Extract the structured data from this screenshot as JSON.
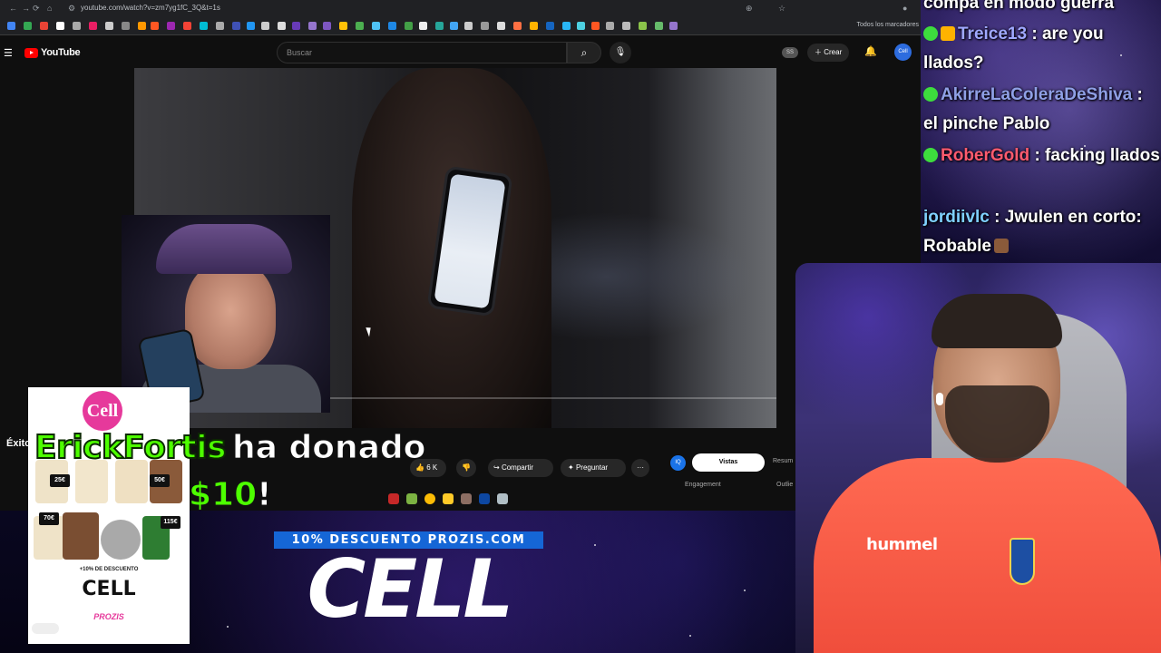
{
  "browser": {
    "url": "youtube.com/watch?v=zm7yg1fC_3Q&t=1s",
    "bookmarks_folder": "Todos los marcadores"
  },
  "youtube": {
    "logo_text": "YouTube",
    "search_placeholder": "Buscar",
    "ss_badge": "SS",
    "create_label": "Crear",
    "avatar_text": "Cell",
    "title_fragment": "Éxito",
    "likes": "6 K",
    "share_label": "Compartir",
    "ask_label": "Preguntar",
    "iq_badge": "IQ",
    "panel_tabs": [
      "Vistas",
      "Resum"
    ],
    "panel_labels": [
      "Engagement",
      "Outlie"
    ]
  },
  "donation": {
    "donor": "ErickFortis",
    "message": "ha donado",
    "amount": "$10",
    "exclaim": "!"
  },
  "ad_card": {
    "logo": "Cell",
    "price_tags": [
      "25€",
      "50€",
      "70€",
      "115€"
    ],
    "promo_line": "+10% DE DESCUENTO",
    "code": "CELL",
    "brand": "PROZIS"
  },
  "promo": {
    "banner": "10% DESCUENTO PROZIS.COM",
    "code": "CELL"
  },
  "chat": {
    "top_fragment": "compa en modo guerra",
    "messages": [
      {
        "user": "Treice13",
        "text": ": are you llados?",
        "color": "#9fa8ff"
      },
      {
        "user": "AkirreLaColeraDeShiva",
        "text": ": el pinche Pablo",
        "color": "#8fa0e6"
      },
      {
        "user": "RoberGold",
        "text": ": facking llados",
        "color": "#ff5a6e"
      },
      {
        "user": "jordiivlc",
        "text": ": Jwulen en corto: Robable",
        "color": "#7fd0ff"
      }
    ]
  },
  "webcam": {
    "jersey_brand": "hummel"
  },
  "colors": {
    "donor_green": "#4dff00",
    "promo_blue": "#1566d6",
    "prozis_pink": "#e6399b",
    "youtube_red": "#ff0000"
  }
}
